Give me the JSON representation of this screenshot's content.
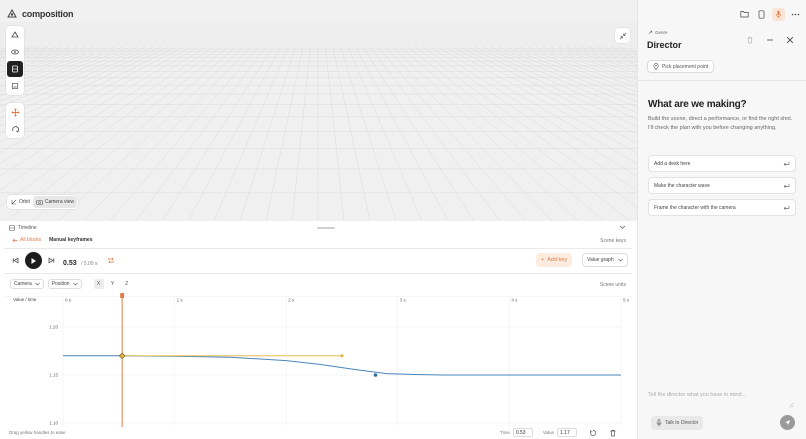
{
  "app": {
    "title": "composition"
  },
  "viewport": {
    "view_modes": [
      "Orbit",
      "Camera view"
    ],
    "selected_view": "Camera view"
  },
  "timeline": {
    "panel_label": "Timeline",
    "back_label": "All blocks",
    "current_label": "Manual keyframes",
    "scene_keys_label": "Scene keys",
    "time_current": "0.53",
    "time_total": "/ 5.00 s",
    "add_key_label": "Add key",
    "graph_mode": "Value graph",
    "object_select": "Camera",
    "property_select": "Position",
    "axes": [
      "X",
      "Y",
      "Z"
    ],
    "active_axis": "X",
    "scene_units_label": "Scene units",
    "graph_label": "Value / time",
    "time_ticks": [
      "0 s",
      "1 s",
      "2 s",
      "3 s",
      "4 s",
      "5 s"
    ],
    "value_ticks": [
      "1.20",
      "1.15",
      "1.10"
    ],
    "footer_hint": "Drag yellow handles to ease",
    "time_field_label": "Time",
    "time_field_value": "0.53",
    "value_field_label": "Value",
    "value_field_value": "1.17"
  },
  "chart_data": {
    "type": "line",
    "title": "",
    "xlabel": "",
    "ylabel": "Value / time",
    "xlim": [
      0,
      5
    ],
    "ylim": [
      1.1,
      1.225
    ],
    "series": [
      {
        "x": [
          0,
          0.53,
          1.0,
          1.5,
          2.0,
          2.3,
          2.6,
          2.9,
          3.15,
          3.4,
          5.0
        ],
        "values": [
          1.17,
          1.17,
          1.1695,
          1.1685,
          1.165,
          1.161,
          1.156,
          1.1515,
          1.1505,
          1.15,
          1.15
        ]
      }
    ],
    "keyframes": [
      {
        "x": 0.53,
        "y": 1.17
      },
      {
        "x": 2.8,
        "y": 1.15
      }
    ],
    "handle": {
      "x": [
        0.53,
        2.5
      ],
      "y": [
        1.17,
        1.17
      ]
    },
    "playhead": 0.53,
    "colors": {
      "curve": "#4a86b8",
      "handle": "#e2b33b",
      "playhead": "#e07b47",
      "keyframe": "#2d6fa3"
    },
    "grid": true
  },
  "director": {
    "genre": "Genre",
    "title": "Director",
    "pick_label": "Pick placement point",
    "hero_title": "What are we making?",
    "hero_desc": "Build the scene, direct a performance, or find the right shot. I'll check the plan with you before changing anything.",
    "suggestions": [
      "Add a desk here",
      "Make the character wave",
      "Frame the character with the camera"
    ],
    "composer_placeholder": "Tell the director what you have in mind...",
    "talk_label": "Talk to Director"
  }
}
